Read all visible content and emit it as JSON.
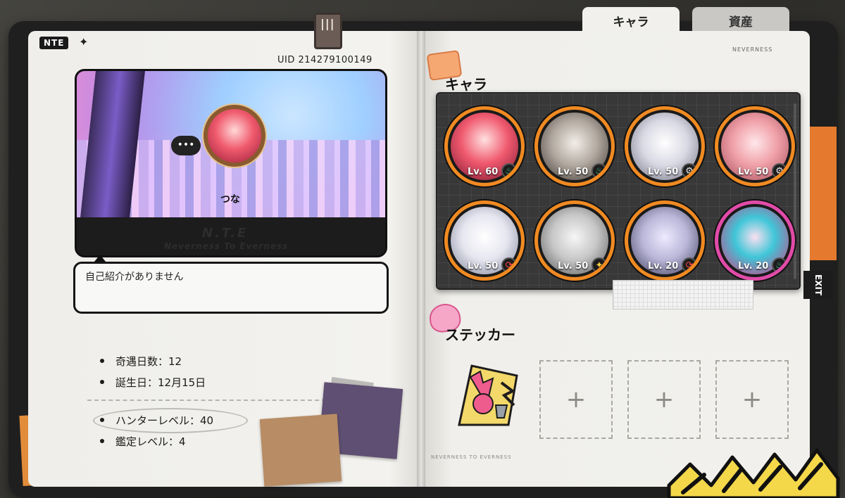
{
  "tabs": [
    {
      "label": "キャラ",
      "active": true
    },
    {
      "label": "資産",
      "active": false
    }
  ],
  "branding": {
    "logo": "NTE",
    "card_watermark": "N.T.E",
    "card_watermark_sub": "Neverness To Everness",
    "right_brand": "NEVERNESS"
  },
  "profile": {
    "uid": "UID  214279100149",
    "nickname": "つな",
    "bio": "自己紹介がありません",
    "stats": [
      {
        "label": "奇遇日数：12"
      },
      {
        "label": "誕生日：12月15日"
      }
    ],
    "levels": [
      {
        "label": "ハンターレベル：40"
      },
      {
        "label": "鑑定レベル：4"
      }
    ]
  },
  "sections": {
    "characters_title": "キャラ",
    "stickers_title": "ステッカー"
  },
  "characters": [
    {
      "level": "Lv. 60",
      "attribute_icon": "water-drop-icon",
      "color": "#f0596e"
    },
    {
      "level": "Lv. 50",
      "attribute_icon": "water-drop-icon",
      "color": "#b2a9a0"
    },
    {
      "level": "Lv. 50",
      "attribute_icon": "gear-icon",
      "color": "#d9d9e4"
    },
    {
      "level": "Lv. 50",
      "attribute_icon": "gear-icon",
      "color": "#f0a0a8"
    },
    {
      "level": "Lv. 50",
      "attribute_icon": "cycle-icon",
      "color": "#e6e6f0"
    },
    {
      "level": "Lv. 50",
      "attribute_icon": "star-icon",
      "color": "#c7c7c7"
    },
    {
      "level": "Lv. 20",
      "attribute_icon": "cycle-icon",
      "color": "#b9b6d8"
    },
    {
      "level": "Lv. 20",
      "attribute_icon": "water-drop-icon",
      "color": "#3fc6d8"
    }
  ],
  "sticker_slots": [
    "+",
    "+",
    "+"
  ],
  "footer": {
    "left": "NEVERNESS TO EVERNESS",
    "right": "NEVERNESS TO EVERNESS"
  },
  "colors": {
    "frame_orange": "#f08a22",
    "frame_pink": "#e14ba8"
  }
}
